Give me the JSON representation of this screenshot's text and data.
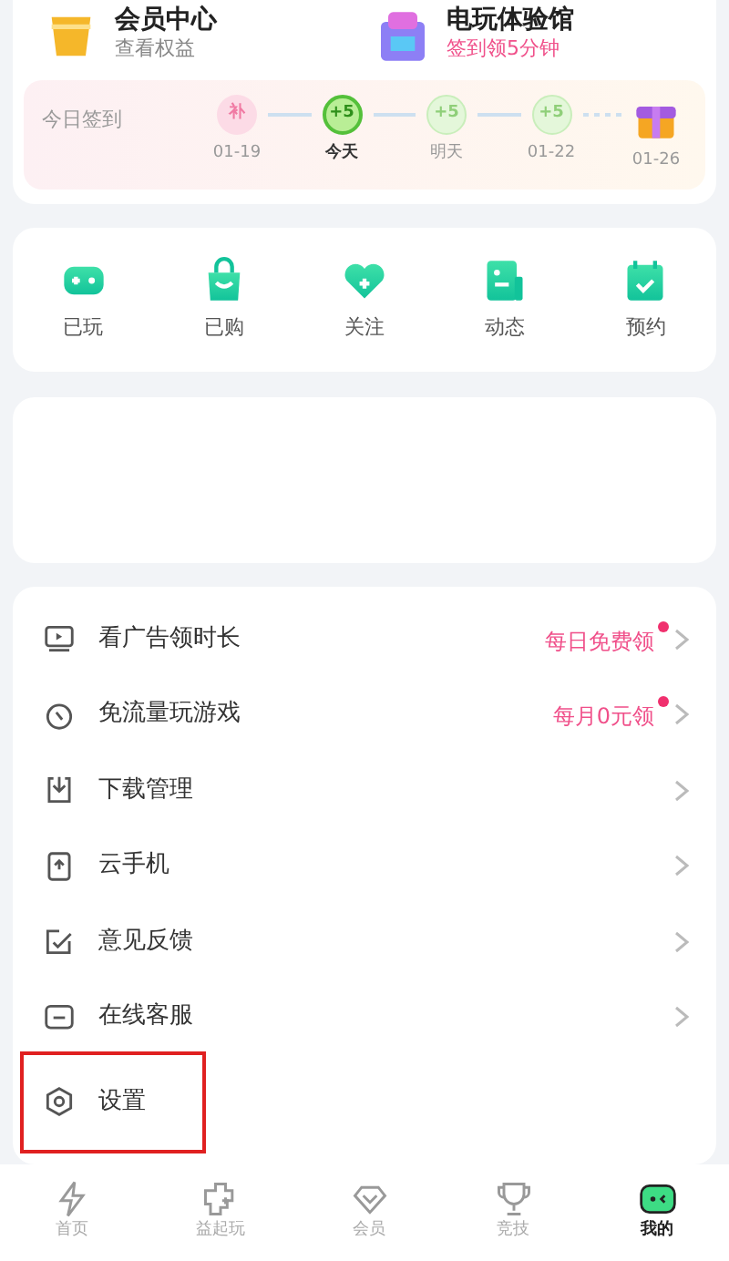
{
  "promos": [
    {
      "title": "会员中心",
      "subtitle": "查看权益",
      "kind": "vip"
    },
    {
      "title": "电玩体验馆",
      "subtitle": "签到领5分钟",
      "kind": "arcade"
    }
  ],
  "checkin": {
    "label": "今日签到",
    "days": [
      {
        "kind": "makeup",
        "mark": "补",
        "date": "01-19",
        "selected": false
      },
      {
        "kind": "reward",
        "mark": "+5",
        "date": "今天",
        "selected": true
      },
      {
        "kind": "reward",
        "mark": "+5",
        "date": "明天",
        "selected": false
      },
      {
        "kind": "reward",
        "mark": "+5",
        "date": "01-22",
        "selected": false
      },
      {
        "kind": "gift",
        "date": "01-26",
        "selected": false
      }
    ]
  },
  "shortcuts": [
    {
      "label": "已玩",
      "kind": "gamepad"
    },
    {
      "label": "已购",
      "kind": "bag"
    },
    {
      "label": "关注",
      "kind": "heart"
    },
    {
      "label": "动态",
      "kind": "feed"
    },
    {
      "label": "预约",
      "kind": "calendar"
    }
  ],
  "menu": [
    {
      "label": "看广告领时长",
      "kind": "tv",
      "note": "每日免费领",
      "dot": true,
      "highlighted": false
    },
    {
      "label": "免流量玩游戏",
      "kind": "data",
      "note": "每月0元领",
      "dot": true,
      "highlighted": false
    },
    {
      "label": "下载管理",
      "kind": "download",
      "dot": false,
      "highlighted": false
    },
    {
      "label": "云手机",
      "kind": "phone",
      "dot": false,
      "highlighted": false
    },
    {
      "label": "意见反馈",
      "kind": "feedback",
      "dot": false,
      "highlighted": false
    },
    {
      "label": "在线客服",
      "kind": "chat",
      "dot": false,
      "highlighted": false
    },
    {
      "label": "设置",
      "kind": "settings",
      "dot": false,
      "highlighted": true
    }
  ],
  "tabbar": [
    {
      "label": "首页",
      "kind": "bolt",
      "selected": false
    },
    {
      "label": "益起玩",
      "kind": "puzzle",
      "selected": false
    },
    {
      "label": "会员",
      "kind": "diamond",
      "selected": false
    },
    {
      "label": "竞技",
      "kind": "trophy",
      "selected": false
    },
    {
      "label": "我的",
      "kind": "face",
      "selected": true
    }
  ]
}
